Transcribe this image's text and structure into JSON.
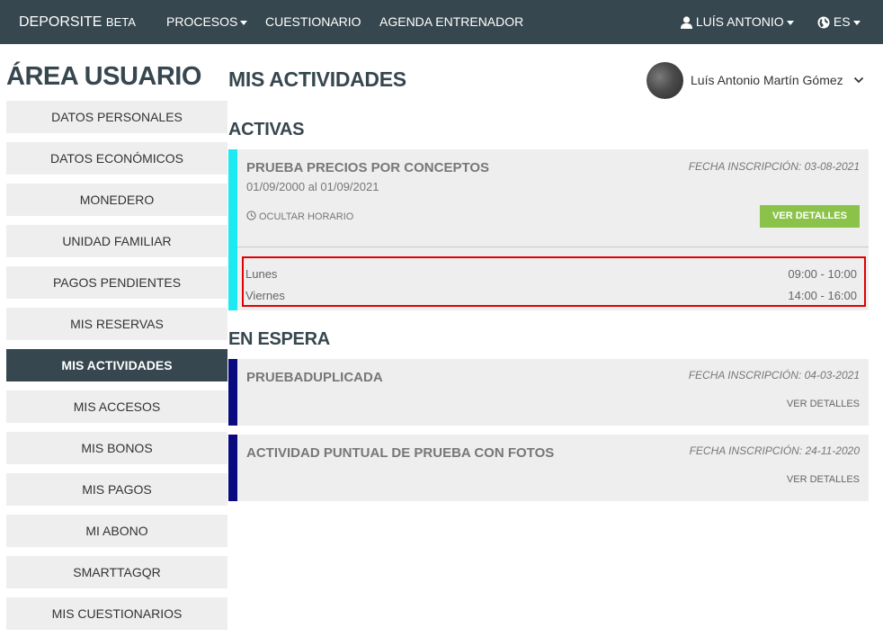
{
  "navbar": {
    "brand": "DEPORSITE",
    "brand_suffix": "BETA",
    "items": [
      "PROCESOS",
      "CUESTIONARIO",
      "AGENDA ENTRENADOR"
    ],
    "user_menu": "LUÍS ANTONIO",
    "language": "ES"
  },
  "sidebar": {
    "title": "ÁREA USUARIO",
    "items": [
      {
        "label": "DATOS PERSONALES"
      },
      {
        "label": "DATOS ECONÓMICOS"
      },
      {
        "label": "MONEDERO"
      },
      {
        "label": "UNIDAD FAMILIAR"
      },
      {
        "label": "PAGOS PENDIENTES"
      },
      {
        "label": "MIS RESERVAS"
      },
      {
        "label": "MIS ACTIVIDADES"
      },
      {
        "label": "MIS ACCESOS"
      },
      {
        "label": "MIS BONOS"
      },
      {
        "label": "MIS PAGOS"
      },
      {
        "label": "MI ABONO"
      },
      {
        "label": "SMARTTAGQR"
      },
      {
        "label": "MIS CUESTIONARIOS"
      }
    ],
    "active_item": "MIS ACTIVIDADES"
  },
  "main": {
    "title": "MIS ACTIVIDADES",
    "user": {
      "name": "Luís Antonio Martín Gómez"
    },
    "active_section": {
      "title": "ACTIVAS",
      "activities": [
        {
          "name": "PRUEBA PRECIOS POR CONCEPTOS",
          "registration": "FECHA INSCRIPCIÓN: 03-08-2021",
          "period": "01/09/2000 al 01/09/2021",
          "toggle_label": "OCULTAR HORARIO",
          "details_label": "VER DETALLES",
          "schedule": [
            {
              "day": "Lunes",
              "time": "09:00 - 10:00"
            },
            {
              "day": "Viernes",
              "time": "14:00 - 16:00"
            }
          ]
        }
      ]
    },
    "waiting_section": {
      "title": "EN ESPERA",
      "activities": [
        {
          "name": "PRUEBADUPLICADA",
          "registration": "FECHA INSCRIPCIÓN: 04-03-2021",
          "details_label": "VER DETALLES"
        },
        {
          "name": "ACTIVIDAD PUNTUAL DE PRUEBA CON FOTOS",
          "registration": "FECHA INSCRIPCIÓN: 24-11-2020",
          "details_label": "VER DETALLES"
        }
      ]
    }
  },
  "colors": {
    "navbar": "#37474f",
    "active_accent": "#1de9f0",
    "waiting_accent": "#0a0a80",
    "button_green": "#8bc34a",
    "highlight_border": "#e00000"
  },
  "icons": {
    "user": "user-icon",
    "globe": "globe-icon",
    "clock": "clock-icon",
    "chevron": "chevron-down-icon"
  }
}
